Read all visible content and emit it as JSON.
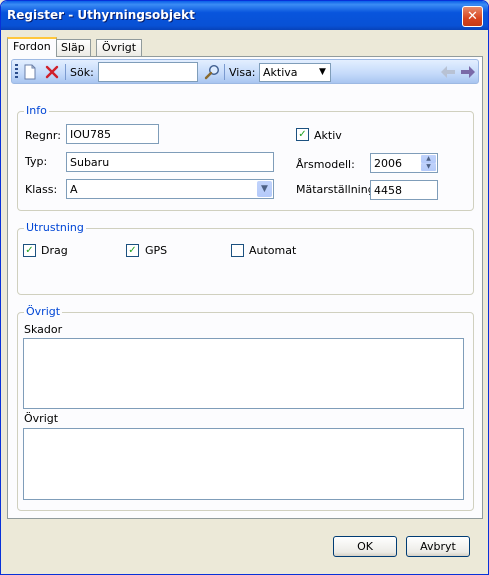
{
  "window": {
    "title": "Register - Uthyrningsobjekt",
    "close_glyph": "✕"
  },
  "tabs": [
    {
      "label": "Fordon"
    },
    {
      "label": "Släp"
    },
    {
      "label": "Övrigt"
    }
  ],
  "toolbar": {
    "search_label": "Sök:",
    "search_value": "",
    "show_label": "Visa:",
    "show_value": "Aktiva",
    "icons": [
      "new-document-icon",
      "delete-icon",
      "search-icon",
      "back-arrow-icon",
      "forward-arrow-icon"
    ]
  },
  "info": {
    "title": "Info",
    "regnr_label": "Regnr:",
    "regnr_value": "IOU785",
    "typ_label": "Typ:",
    "typ_value": "Subaru",
    "klass_label": "Klass:",
    "klass_value": "A",
    "aktiv_label": "Aktiv",
    "aktiv_checked": true,
    "arsmodell_label": "Årsmodell:",
    "arsmodell_value": "2006",
    "matarstallning_label": "Mätarställning:",
    "matarstallning_value": "4458"
  },
  "utrustning": {
    "title": "Utrustning",
    "items": [
      {
        "label": "Drag",
        "checked": true
      },
      {
        "label": "GPS",
        "checked": true
      },
      {
        "label": "Automat",
        "checked": false
      }
    ]
  },
  "ovrigt": {
    "title": "Övrigt",
    "skador_label": "Skador",
    "skador_value": "",
    "ovrigt_label": "Övrigt",
    "ovrigt_value": ""
  },
  "buttons": {
    "ok": "OK",
    "cancel": "Avbryt"
  },
  "colors": {
    "titlebar": "#0855DD",
    "group_title": "#0046D5",
    "check": "#21A121"
  }
}
